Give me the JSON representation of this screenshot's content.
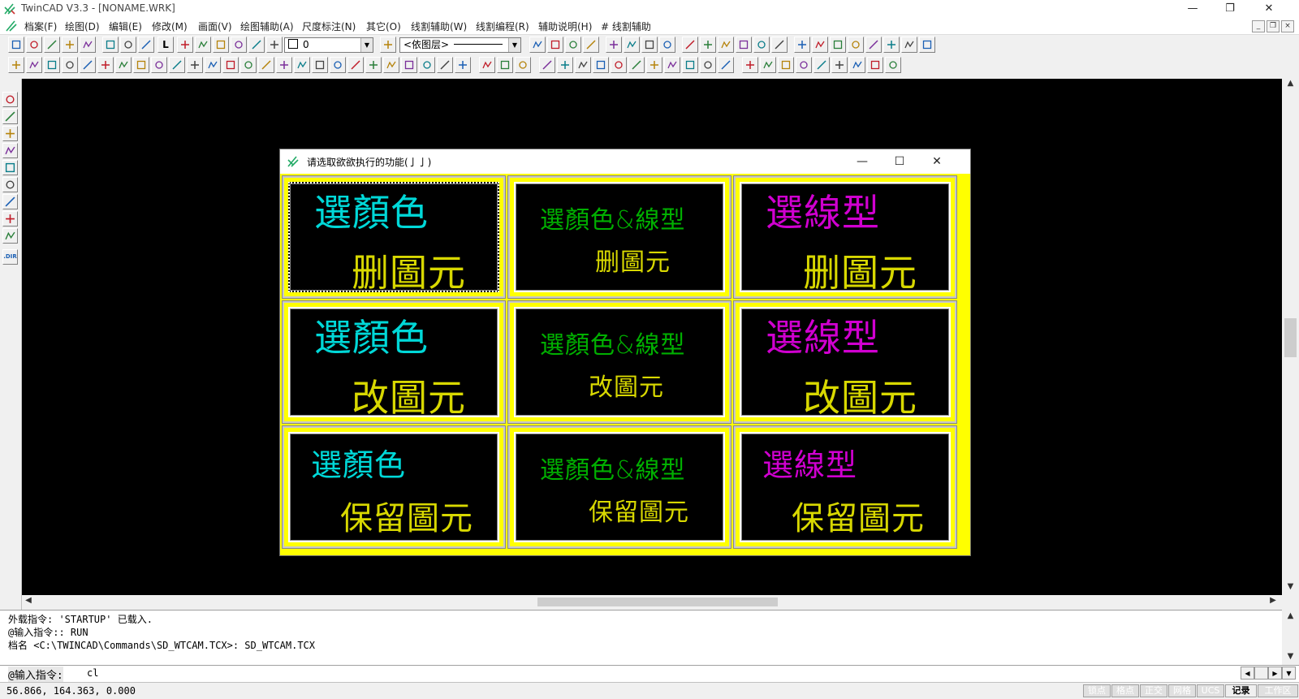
{
  "window": {
    "title": "TwinCAD V3.3 - [NONAME.WRK]",
    "minimize_glyph": "—",
    "restore_glyph": "❐",
    "close_glyph": "✕"
  },
  "menu": {
    "items": [
      "档案(F)",
      "绘图(D)",
      "编辑(E)",
      "修改(M)",
      "画面(V)",
      "绘图辅助(A)",
      "尺度标注(N)",
      "其它(O)",
      "线割辅助(W)",
      "线割编程(R)",
      "辅助说明(H)",
      "# 线割辅助"
    ],
    "mdi_buttons": [
      "_",
      "❐",
      "×"
    ]
  },
  "toolbar": {
    "layer_letter": "L",
    "color_combo_value": "0",
    "layer_combo_value": "<依图层>",
    "icons_row1": [
      "new-icon",
      "open-icon",
      "save-icon",
      "print-icon",
      "preview-icon",
      "cut-icon",
      "copy-icon",
      "paste-icon",
      "layer-icon",
      "layer-prev-icon",
      "layer-set-icon",
      "layer-off-icon",
      "layer-lock-icon",
      "linetype-icon",
      "undo-icon",
      "redo-icon",
      "help-icon",
      "whatis-icon",
      "redraw-icon",
      "regen-icon",
      "zoom-window-icon",
      "zoom-prev-icon",
      "zoom-all-icon",
      "pan-icon",
      "grid-icon",
      "snap-icon",
      "calc-icon",
      "money-icon",
      "arc-icon",
      "fillet-icon",
      "text-icon",
      "array-icon",
      "measure-icon",
      "target-icon",
      "dim-icon",
      "wave-icon"
    ],
    "icons_row2": [
      "erase-icon",
      "break-icon",
      "move-icon",
      "rotate-icon",
      "scale-icon",
      "mirror-icon",
      "offset-icon",
      "trim-icon",
      "extend-icon",
      "chamfer-icon",
      "fillet2-icon",
      "explode-icon",
      "stretch-icon",
      "hatch-icon",
      "point-icon",
      "dimension-icon",
      "align-icon",
      "block-icon",
      "insert-icon",
      "pattern-icon",
      "grid2-icon",
      "snapmode-icon",
      "fill-icon",
      "line-icon",
      "ruler-icon",
      "cursor-icon",
      "walk-icon",
      "gear-icon",
      "dim-h-icon",
      "dim-v-icon",
      "dim-a-icon",
      "dim-r-icon",
      "dim-d-icon",
      "dim-o-icon",
      "dim-c-icon",
      "dim-l-icon",
      "dim-p-icon",
      "center-icon",
      "cross-icon",
      "table-icon",
      "abc-icon",
      "palette-icon",
      "list-icon",
      "eraser-icon",
      "zoom-in-icon",
      "zoom-out-icon",
      "ortho-icon",
      "blank-icon",
      "image-icon"
    ]
  },
  "left_toolbar": {
    "icons": [
      "circle-center-icon",
      "line-diag-icon",
      "cross-x-icon",
      "arrow-line-icon",
      "break-point-icon",
      "spark-icon",
      "perp-icon",
      "ring-icon",
      "search-pin-icon"
    ],
    "dir_label": ".DIR"
  },
  "dialog": {
    "title": "请选取欲欲执行的功能(亅亅)",
    "close_glyph": "✕",
    "max_glyph": "☐",
    "min_glyph": "—",
    "cells": [
      {
        "top_text": "選顏色",
        "top_color": "cyan",
        "bottom_text": "删圖元"
      },
      {
        "top_text": "選顏色&線型",
        "top_color": "green",
        "bottom_text": "删圖元"
      },
      {
        "top_text": "選線型",
        "top_color": "magenta",
        "bottom_text": "删圖元"
      },
      {
        "top_text": "選顏色",
        "top_color": "cyan",
        "bottom_text": "改圖元"
      },
      {
        "top_text": "選顏色&線型",
        "top_color": "green",
        "bottom_text": "改圖元"
      },
      {
        "top_text": "選線型",
        "top_color": "magenta",
        "bottom_text": "改圖元"
      },
      {
        "top_text": "選顏色",
        "top_color": "cyan",
        "bottom_text": "保留圖元"
      },
      {
        "top_text": "選顏色&線型",
        "top_color": "green",
        "bottom_text": "保留圖元"
      },
      {
        "top_text": "選線型",
        "top_color": "magenta",
        "bottom_text": "保留圖元"
      }
    ]
  },
  "command": {
    "history": [
      "外载指令: 'STARTUP' 已载入.",
      "@输入指令:: RUN",
      "档名 <C:\\TWINCAD\\Commands\\SD_WTCAM.TCX>: SD_WTCAM.TCX"
    ],
    "prompt": "@输入指令:",
    "input_value": "cl"
  },
  "status": {
    "coordinates": "56.866, 164.363, 0.000",
    "toggles": [
      {
        "label": "锁点",
        "on": false
      },
      {
        "label": "格点",
        "on": false
      },
      {
        "label": "正交",
        "on": false
      },
      {
        "label": "网格",
        "on": false
      },
      {
        "label": "UCS",
        "on": false
      },
      {
        "label": "记录",
        "on": true
      },
      {
        "label": "工作区",
        "on": false
      }
    ]
  },
  "colors": {
    "canvas": "#000000",
    "dialog_border": "#ffff00",
    "cyan": "#00d8d8",
    "green": "#00b000",
    "magenta": "#d000d0",
    "yellow": "#d8d800"
  }
}
